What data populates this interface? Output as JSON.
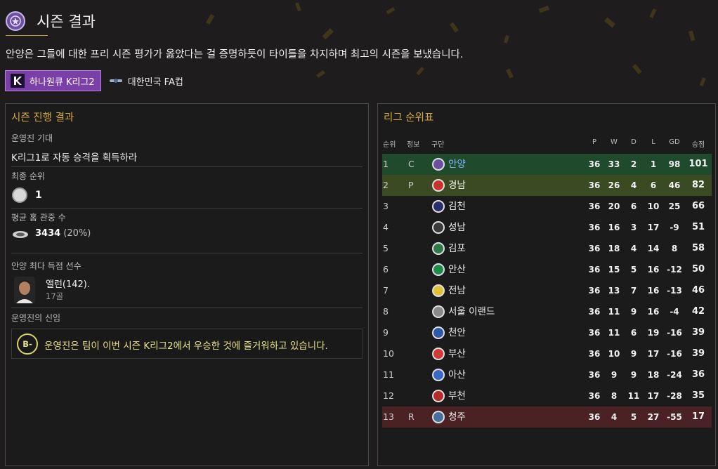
{
  "header": {
    "title": "시즌 결과",
    "summary": "안양은 그들에 대한 프리 시즌 평가가 옳았다는 걸 증명하듯이 타이틀을 차지하며 최고의 시즌을 보냈습니다."
  },
  "competitions": [
    {
      "label": "하나원큐 K리그2",
      "icon": "k-league-icon",
      "active": true
    },
    {
      "label": "대한민국 FA컵",
      "icon": "fa-cup-icon",
      "active": false
    }
  ],
  "season_review": {
    "title": "시즌 진행 결과",
    "board_expectation_label": "운영진 기대",
    "board_expectation_value": "K리그1로 자동 승격을 획득하라",
    "final_position_label": "최종 순위",
    "final_position_value": "1",
    "avg_attendance_label": "평균 홈 관중 수",
    "avg_attendance_value": "3434",
    "avg_attendance_pct": "(20%)",
    "top_scorer_label": "안양 최다 득점 선수",
    "top_scorer_name": "앨런(142).",
    "top_scorer_goals": "17골",
    "board_confidence_label": "운영진의 신임",
    "board_confidence_grade": "B-",
    "board_confidence_text": "운영진은 팀이 이번 시즌 K리그2에서 우승한 것에 즐거워하고 있습니다."
  },
  "league_table": {
    "title": "리그 순위표",
    "headers": {
      "pos": "순위",
      "info": "정보",
      "team": "구단",
      "p": "P",
      "w": "W",
      "d": "D",
      "l": "L",
      "gd": "GD",
      "pts": "승점"
    },
    "rows": [
      {
        "pos": "1",
        "info": "C",
        "team": "안양",
        "p": "36",
        "w": "33",
        "d": "2",
        "l": "1",
        "gd": "98",
        "pts": "101",
        "status": "champion",
        "crest_color": "#6b4fa0"
      },
      {
        "pos": "2",
        "info": "P",
        "team": "경남",
        "p": "36",
        "w": "26",
        "d": "4",
        "l": "6",
        "gd": "46",
        "pts": "82",
        "status": "promoted",
        "crest_color": "#c8342b"
      },
      {
        "pos": "3",
        "info": "",
        "team": "김천",
        "p": "36",
        "w": "20",
        "d": "6",
        "l": "10",
        "gd": "25",
        "pts": "66",
        "status": "",
        "crest_color": "#2a2f6b"
      },
      {
        "pos": "4",
        "info": "",
        "team": "성남",
        "p": "36",
        "w": "16",
        "d": "3",
        "l": "17",
        "gd": "-9",
        "pts": "51",
        "status": "",
        "crest_color": "#3b3b3b"
      },
      {
        "pos": "5",
        "info": "",
        "team": "김포",
        "p": "36",
        "w": "18",
        "d": "4",
        "l": "14",
        "gd": "8",
        "pts": "58",
        "status": "",
        "crest_color": "#2f7a48"
      },
      {
        "pos": "6",
        "info": "",
        "team": "안산",
        "p": "36",
        "w": "15",
        "d": "5",
        "l": "16",
        "gd": "-12",
        "pts": "50",
        "status": "",
        "crest_color": "#1f8a4a"
      },
      {
        "pos": "7",
        "info": "",
        "team": "전남",
        "p": "36",
        "w": "13",
        "d": "7",
        "l": "16",
        "gd": "-13",
        "pts": "46",
        "status": "",
        "crest_color": "#e0c23a"
      },
      {
        "pos": "8",
        "info": "",
        "team": "서울 이랜드",
        "p": "36",
        "w": "11",
        "d": "9",
        "l": "16",
        "gd": "-4",
        "pts": "42",
        "status": "",
        "crest_color": "#8a8a8a"
      },
      {
        "pos": "9",
        "info": "",
        "team": "천안",
        "p": "36",
        "w": "11",
        "d": "6",
        "l": "19",
        "gd": "-16",
        "pts": "39",
        "status": "",
        "crest_color": "#2d5aa8"
      },
      {
        "pos": "10",
        "info": "",
        "team": "부산",
        "p": "36",
        "w": "10",
        "d": "9",
        "l": "17",
        "gd": "-16",
        "pts": "39",
        "status": "",
        "crest_color": "#d23a3a"
      },
      {
        "pos": "11",
        "info": "",
        "team": "아산",
        "p": "36",
        "w": "9",
        "d": "9",
        "l": "18",
        "gd": "-24",
        "pts": "36",
        "status": "",
        "crest_color": "#3a6ac8"
      },
      {
        "pos": "12",
        "info": "",
        "team": "부천",
        "p": "36",
        "w": "8",
        "d": "11",
        "l": "17",
        "gd": "-28",
        "pts": "35",
        "status": "",
        "crest_color": "#b52a2a"
      },
      {
        "pos": "13",
        "info": "R",
        "team": "청주",
        "p": "36",
        "w": "4",
        "d": "5",
        "l": "27",
        "gd": "-55",
        "pts": "17",
        "status": "relegated",
        "crest_color": "#4a6f9c"
      }
    ]
  },
  "colors": {
    "accent_gold": "#d6a93b",
    "champion_row": "#1f4a2c",
    "promoted_row": "#3a4a22",
    "relegated_row": "#4a2224",
    "active_tab": "#7b3fa8"
  }
}
